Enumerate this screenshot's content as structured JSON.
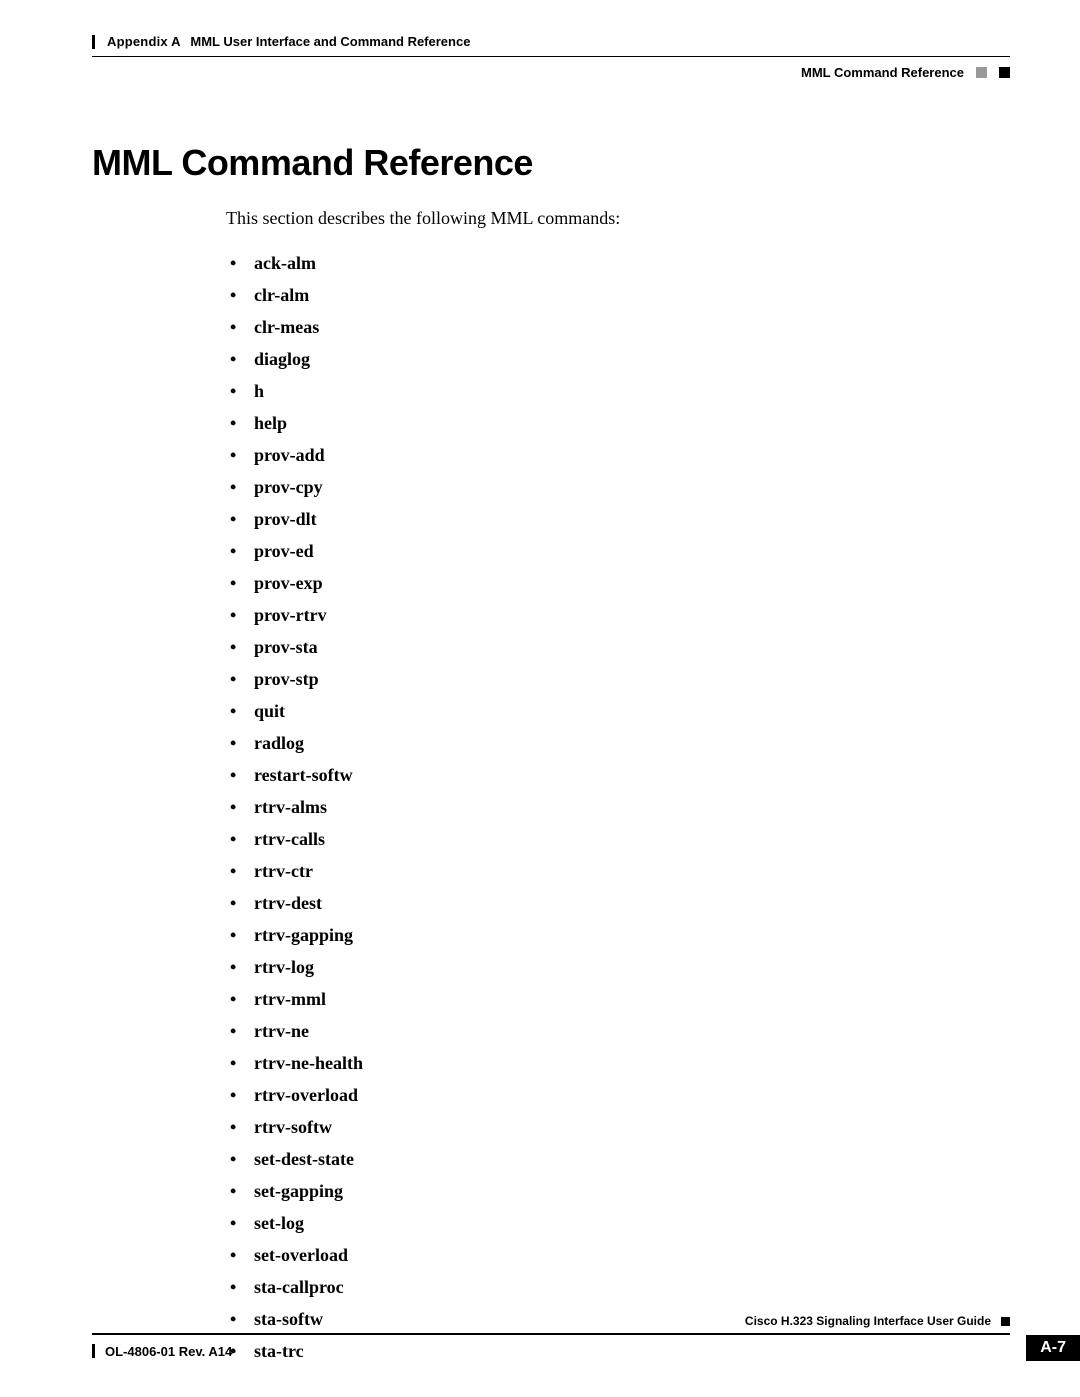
{
  "header": {
    "appendix_label": "Appendix A",
    "appendix_title": "MML User Interface and Command Reference",
    "section_title": "MML Command Reference"
  },
  "body": {
    "h1": "MML Command Reference",
    "intro": "This section describes the following MML commands:",
    "commands": [
      "ack-alm",
      "clr-alm",
      "clr-meas",
      "diaglog",
      "h",
      "help",
      "prov-add",
      "prov-cpy",
      "prov-dlt",
      "prov-ed",
      "prov-exp",
      "prov-rtrv",
      "prov-sta",
      "prov-stp",
      "quit",
      "radlog",
      "restart-softw",
      "rtrv-alms",
      "rtrv-calls",
      "rtrv-ctr",
      "rtrv-dest",
      "rtrv-gapping",
      "rtrv-log",
      "rtrv-mml",
      "rtrv-ne",
      "rtrv-ne-health",
      "rtrv-overload",
      "rtrv-softw",
      "set-dest-state",
      "set-gapping",
      "set-log",
      "set-overload",
      "sta-callproc",
      "sta-softw",
      "sta-trc"
    ]
  },
  "footer": {
    "guide": "Cisco H.323 Signaling Interface User Guide",
    "revision": "OL-4806-01 Rev. A14",
    "page_badge": "A-7"
  }
}
